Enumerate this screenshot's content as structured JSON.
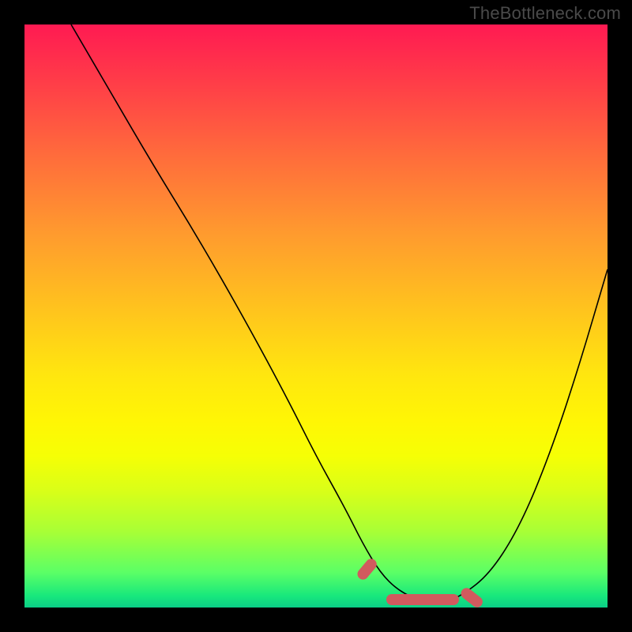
{
  "watermark": "TheBottleneck.com",
  "chart_data": {
    "type": "line",
    "title": "",
    "xlabel": "",
    "ylabel": "",
    "xlim": [
      0,
      100
    ],
    "ylim": [
      0,
      100
    ],
    "series": [
      {
        "name": "curve",
        "x": [
          8,
          15,
          22,
          30,
          38,
          45,
          50,
          55,
          58,
          61,
          64,
          68,
          72,
          75,
          80,
          85,
          90,
          95,
          100
        ],
        "values": [
          100,
          88,
          76,
          63,
          49,
          36,
          26,
          17,
          11,
          6,
          3,
          1,
          1,
          2,
          6,
          14,
          26,
          41,
          58
        ]
      }
    ],
    "highlights": [
      {
        "x_start": 57.5,
        "x_end": 61.5,
        "y": 5,
        "angle_deg": -50
      },
      {
        "x_start": 62,
        "x_end": 74.5,
        "y": 1.3,
        "angle_deg": 0
      },
      {
        "x_start": 75,
        "x_end": 79.2,
        "y": 3,
        "angle_deg": 38
      }
    ],
    "gradient_note": "red(top)->orange->yellow->green(bottom)"
  }
}
